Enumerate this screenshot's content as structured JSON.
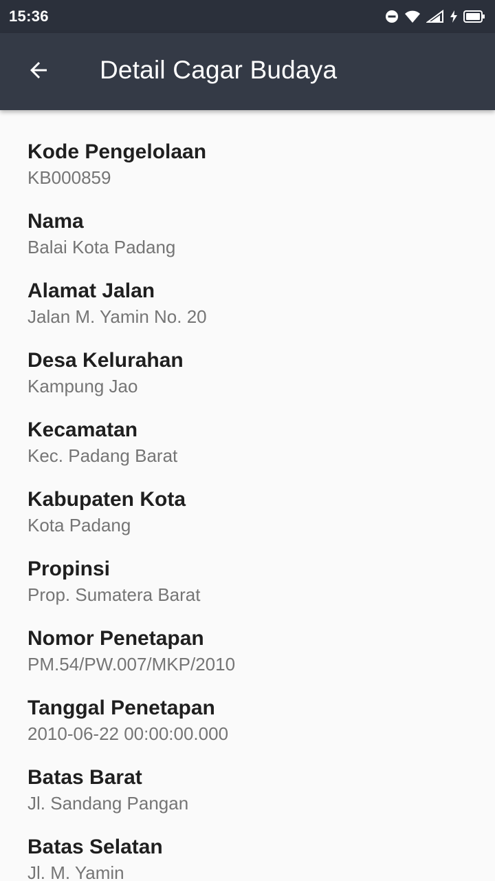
{
  "status_bar": {
    "time": "15:36",
    "icons": [
      "dnd-icon",
      "wifi-icon",
      "signal-icon",
      "charging-icon",
      "battery-icon"
    ]
  },
  "app_bar": {
    "title": "Detail Cagar Budaya",
    "back_icon": "arrow-back-icon"
  },
  "colors": {
    "status_bar": "#2b303b",
    "app_bar": "#343a46",
    "background": "#fafafa",
    "label": "#1f1f1f",
    "value": "#757575"
  },
  "fields": [
    {
      "label": "Kode Pengelolaan",
      "value": "KB000859"
    },
    {
      "label": "Nama",
      "value": "Balai Kota Padang"
    },
    {
      "label": "Alamat Jalan",
      "value": "Jalan M. Yamin No. 20"
    },
    {
      "label": "Desa Kelurahan",
      "value": "Kampung Jao"
    },
    {
      "label": "Kecamatan",
      "value": "Kec. Padang Barat"
    },
    {
      "label": "Kabupaten Kota",
      "value": "Kota Padang"
    },
    {
      "label": "Propinsi",
      "value": "Prop. Sumatera Barat"
    },
    {
      "label": "Nomor Penetapan",
      "value": "PM.54/PW.007/MKP/2010"
    },
    {
      "label": "Tanggal Penetapan",
      "value": "2010-06-22 00:00:00.000"
    },
    {
      "label": "Batas Barat",
      "value": "Jl. Sandang Pangan"
    },
    {
      "label": "Batas Selatan",
      "value": "Jl. M. Yamin"
    }
  ]
}
